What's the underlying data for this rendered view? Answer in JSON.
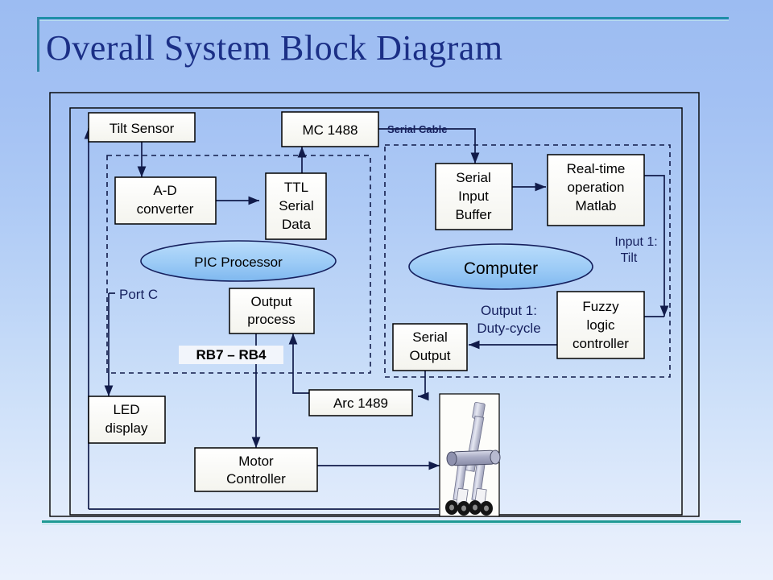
{
  "slide": {
    "title": "Overall System Block Diagram",
    "accent_color": "#1f8fa8",
    "title_color": "#1b2f86",
    "background_top": "#9cbcf2",
    "background_bottom": "#eaf1fd"
  },
  "diagram": {
    "type": "block-diagram",
    "boxes": [
      {
        "id": "tilt-sensor",
        "label": "Tilt Sensor"
      },
      {
        "id": "mc-1488",
        "label": "MC 1488"
      },
      {
        "id": "ad-converter",
        "label": "A-D\nconverter",
        "line1": "A-D",
        "line2": "converter"
      },
      {
        "id": "ttl-serial-data",
        "label": "TTL Serial Data",
        "line1": "TTL",
        "line2": "Serial",
        "line3": "Data"
      },
      {
        "id": "output-process",
        "label": "Output process",
        "line1": "Output",
        "line2": "process"
      },
      {
        "id": "led-display",
        "label": "LED display",
        "line1": "LED",
        "line2": "display"
      },
      {
        "id": "motor-controller",
        "label": "Motor Controller",
        "line1": "Motor",
        "line2": "Controller"
      },
      {
        "id": "arc-1489",
        "label": "Arc 1489"
      },
      {
        "id": "serial-input-buffer",
        "label": "Serial Input Buffer",
        "line1": "Serial",
        "line2": "Input",
        "line3": "Buffer"
      },
      {
        "id": "realtime-matlab",
        "label": "Real-time operation Matlab",
        "line1": "Real-time",
        "line2": "operation",
        "line3": "Matlab"
      },
      {
        "id": "fuzzy-controller",
        "label": "Fuzzy logic controller",
        "line1": "Fuzzy",
        "line2": "logic",
        "line3": "controller"
      },
      {
        "id": "serial-output",
        "label": "Serial Output",
        "line1": "Serial",
        "line2": "Output"
      }
    ],
    "ellipses": [
      {
        "id": "pic-processor",
        "label": "PIC Processor",
        "fill": "#9ecbf5"
      },
      {
        "id": "computer",
        "label": "Computer",
        "fill": "#9ecbf5"
      }
    ],
    "labels": [
      {
        "id": "serial-cable",
        "text": "Serial Cable",
        "bold": true
      },
      {
        "id": "port-c",
        "text": "Port C"
      },
      {
        "id": "rb-range",
        "text": "RB7 – RB4",
        "bold": true
      },
      {
        "id": "input-1",
        "line1": "Input 1:",
        "line2": "Tilt"
      },
      {
        "id": "output-1",
        "line1": "Output 1:",
        "line2": "Duty-cycle"
      }
    ],
    "groups": [
      {
        "id": "pic-group",
        "label": "PIC Processor group",
        "style": "dashed"
      },
      {
        "id": "computer-group",
        "label": "Computer group",
        "style": "dashed"
      }
    ],
    "robot": {
      "id": "robot-photo",
      "label": "Two-wheeled balancing robot"
    }
  }
}
